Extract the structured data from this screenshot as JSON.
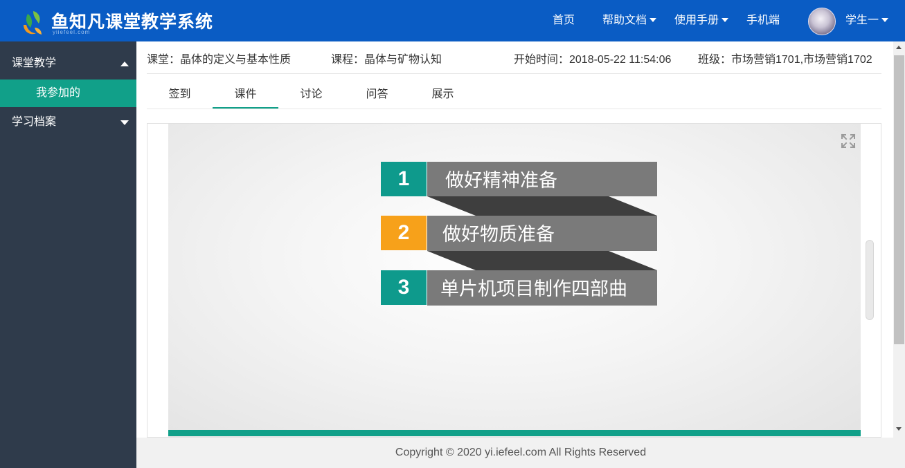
{
  "header": {
    "app_title": "鱼知凡课堂教学系统",
    "app_subtitle": "yiiefeel.com",
    "nav": [
      {
        "label": "首页",
        "dropdown": false
      },
      {
        "label": "帮助文档",
        "dropdown": true
      },
      {
        "label": "使用手册",
        "dropdown": true
      },
      {
        "label": "手机端",
        "dropdown": false
      }
    ],
    "user_name": "学生一"
  },
  "sidebar": {
    "groups": [
      {
        "label": "课堂教学",
        "expanded": true,
        "items": [
          {
            "label": "我参加的",
            "active": true
          }
        ]
      },
      {
        "label": "学习档案",
        "expanded": false,
        "items": []
      }
    ]
  },
  "classroom_info": {
    "classroom": "课堂：晶体的定义与基本性质",
    "course": "课程：晶体与矿物认知",
    "start_time": "开始时间：2018-05-22 11:54:06",
    "class": "班级：市场营销1701,市场营销1702"
  },
  "tabs": [
    {
      "label": "签到",
      "active": false
    },
    {
      "label": "课件",
      "active": true
    },
    {
      "label": "讨论",
      "active": false
    },
    {
      "label": "问答",
      "active": false
    },
    {
      "label": "展示",
      "active": false
    }
  ],
  "slide": {
    "items": [
      {
        "number": "1",
        "text": "做好精神准备",
        "color": "#0e9a8c"
      },
      {
        "number": "2",
        "text": "做好物质准备",
        "color": "#f7a11a"
      },
      {
        "number": "3",
        "text": "单片机项目制作四部曲",
        "color": "#0e9a8c"
      }
    ]
  },
  "footer": {
    "copyright": "Copyright © 2020 yi.iefeel.com All Rights Reserved"
  },
  "colors": {
    "header_bg": "#0a5cc4",
    "sidebar_bg": "#2f3b4b",
    "accent": "#11a089",
    "item_gray": "#7a7a7a",
    "fold_dark": "#3e3e3e"
  },
  "icons": {
    "logo": "fish-logo-icon",
    "fullscreen": "expand-icon",
    "dropdown": "caret-down-icon"
  }
}
